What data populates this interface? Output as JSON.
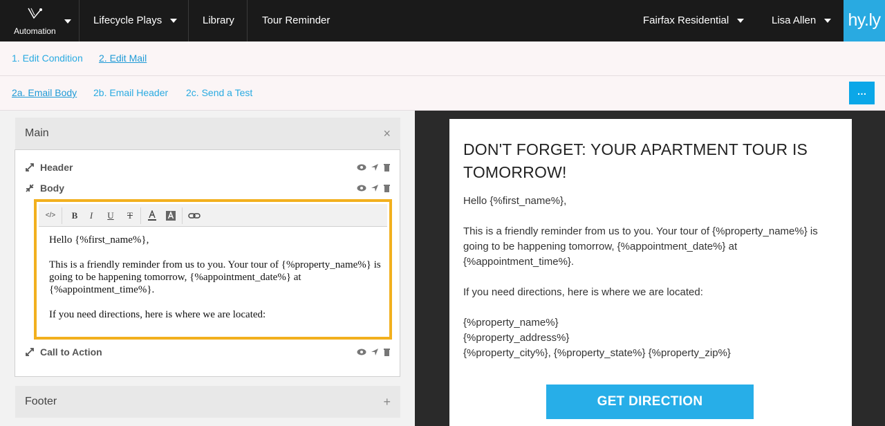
{
  "nav": {
    "automation_label": "Automation",
    "lifecycle_label": "Lifecycle Plays",
    "library_label": "Library",
    "tour_label": "Tour Reminder",
    "property_label": "Fairfax Residential",
    "user_label": "Lisa Allen",
    "brand": "hy.ly"
  },
  "steps": {
    "edit_condition": "1. Edit Condition",
    "edit_mail": "2. Edit Mail",
    "email_body": "2a. Email Body",
    "email_header": "2b. Email Header",
    "send_test": "2c. Send a Test",
    "more_label": "…"
  },
  "sections": {
    "main_title": "Main",
    "main_close": "×",
    "footer_title": "Footer",
    "footer_add": "+",
    "rows": [
      {
        "label": "Header"
      },
      {
        "label": "Body"
      },
      {
        "label": "Call to Action"
      }
    ]
  },
  "editor": {
    "toolbar": {
      "code": "</>",
      "bold": "B",
      "italic": "I",
      "underline": "U",
      "strike": "T"
    },
    "paragraphs": [
      "Hello {%first_name%},",
      "This is a friendly reminder from us to you. Your tour of {%property_name%} is going to be happening tomorrow, {%appointment_date%} at {%appointment_time%}.",
      "If you need directions, here is where we are located:"
    ]
  },
  "preview": {
    "heading": "DON'T FORGET: YOUR APARTMENT TOUR IS TOMORROW!",
    "greeting": "Hello {%first_name%},",
    "reminder": "This is a friendly reminder from us to you. Your tour of {%property_name%} is going to be happening tomorrow, {%appointment_date%} at {%appointment_time%}.",
    "directions": "If you need directions, here is where we are located:",
    "address_line1": "{%property_name%}",
    "address_line2": "{%property_address%}",
    "address_line3": "{%property_city%}, {%property_state%} {%property_zip%}",
    "cta_label": "GET DIRECTION"
  },
  "colors": {
    "accent": "#29aae1",
    "highlight": "#f2b01e",
    "nav_bg": "#1a1a1a"
  }
}
